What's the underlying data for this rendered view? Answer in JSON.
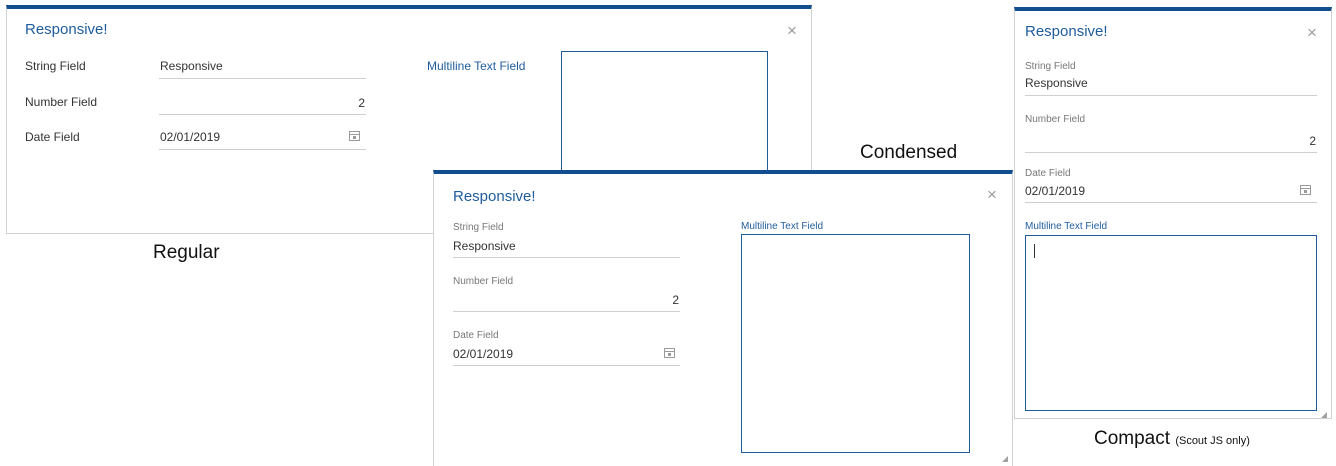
{
  "dialog_title": "Responsive!",
  "close_icon": "close-icon",
  "fields": {
    "string_label": "String Field",
    "string_value": "Responsive",
    "number_label": "Number Field",
    "number_value": "2",
    "date_label": "Date Field",
    "date_value": "02/01/2019",
    "multiline_label": "Multiline Text Field"
  },
  "captions": {
    "regular": "Regular",
    "condensed": "Condensed",
    "compact": "Compact",
    "compact_note": "(Scout JS only)"
  },
  "colors": {
    "accent": "#114d8f",
    "title": "#1f5c9c"
  }
}
